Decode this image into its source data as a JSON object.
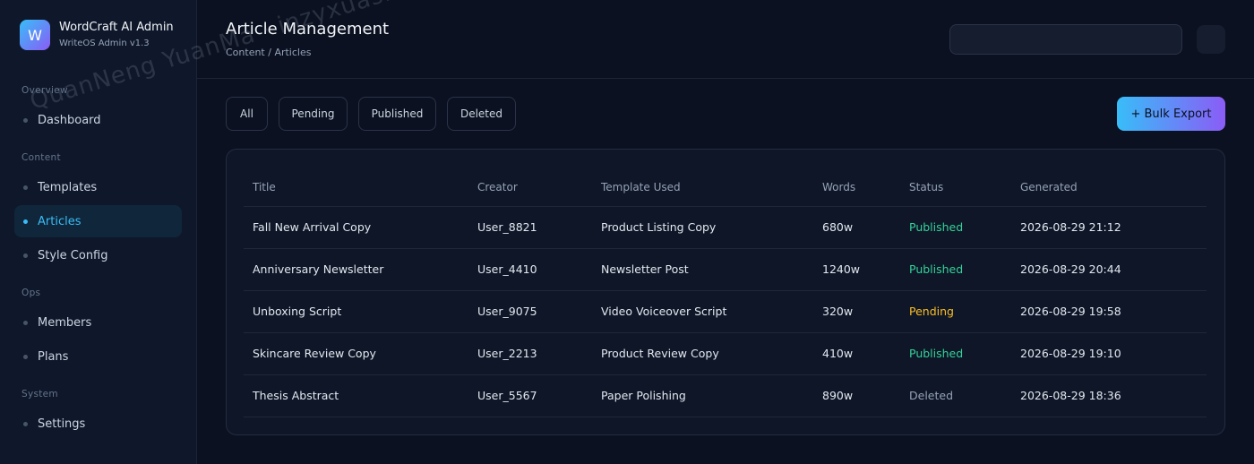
{
  "brand": {
    "logo_letter": "W",
    "title": "WordCraft AI Admin",
    "subtitle": "WriteOS Admin v1.3"
  },
  "sidebar": {
    "sections": [
      {
        "label": "Overview",
        "items": [
          {
            "label": "Dashboard"
          }
        ]
      },
      {
        "label": "Content",
        "items": [
          {
            "label": "Templates"
          },
          {
            "label": "Articles",
            "active": true
          },
          {
            "label": "Style Config"
          }
        ]
      },
      {
        "label": "Ops",
        "items": [
          {
            "label": "Members"
          },
          {
            "label": "Plans"
          }
        ]
      },
      {
        "label": "System",
        "items": [
          {
            "label": "Settings"
          }
        ]
      }
    ]
  },
  "header": {
    "title": "Article Management",
    "breadcrumb": "Content / Articles",
    "search_value": ""
  },
  "filters": [
    "All",
    "Pending",
    "Published",
    "Deleted"
  ],
  "actions": {
    "export_label": "+ Bulk Export"
  },
  "table": {
    "columns": [
      "Title",
      "Creator",
      "Template Used",
      "Words",
      "Status",
      "Generated"
    ],
    "rows": [
      [
        "Fall New Arrival Copy",
        "User_8821",
        "Product Listing Copy",
        "680w",
        "Published",
        "2026-08-29 21:12"
      ],
      [
        "Anniversary Newsletter",
        "User_4410",
        "Newsletter Post",
        "1240w",
        "Published",
        "2026-08-29 20:44"
      ],
      [
        "Unboxing Script",
        "User_9075",
        "Video Voiceover Script",
        "320w",
        "Pending",
        "2026-08-29 19:58"
      ],
      [
        "Skincare Review Copy",
        "User_2213",
        "Product Review Copy",
        "410w",
        "Published",
        "2026-08-29 19:10"
      ],
      [
        "Thesis Abstract",
        "User_5567",
        "Paper Polishing",
        "890w",
        "Deleted",
        "2026-08-29 18:36"
      ]
    ]
  },
  "status_colors": {
    "Published": "#34d399",
    "Pending": "#fbbf24",
    "Deleted": "#94a3b8"
  },
  "accent": "#38bdf8",
  "watermark": "QuanNeng YuanMa · inzyxuashop.com"
}
